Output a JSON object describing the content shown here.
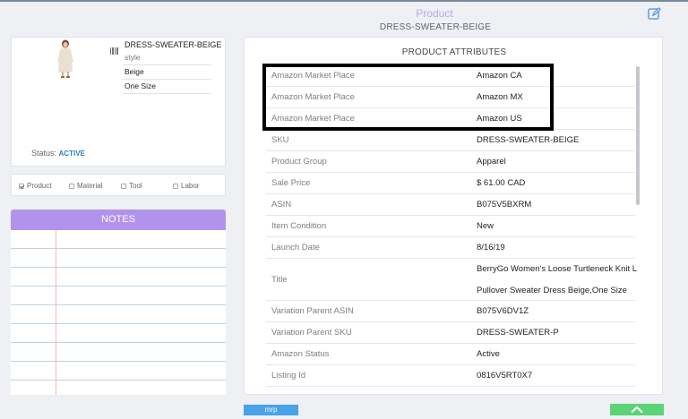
{
  "header": {
    "title": "Product",
    "subtitle": "DRESS-SWEATER-BEIGE",
    "edit_icon": "edit-icon"
  },
  "product_card": {
    "sku": "DRESS-SWEATER-BEIGE",
    "style_placeholder": "style",
    "color": "Beige",
    "size": "One Size",
    "status_label": "Status:",
    "status_value": "ACTIVE",
    "status_color": "#2f7fbf"
  },
  "types": [
    {
      "label": "Product",
      "checked": true
    },
    {
      "label": "Material",
      "checked": false
    },
    {
      "label": "Tool",
      "checked": false
    },
    {
      "label": "Labor",
      "checked": false
    }
  ],
  "notes": {
    "title": "NOTES",
    "header_color": "#b193ee"
  },
  "attributes": {
    "title": "PRODUCT ATTRIBUTES",
    "rows": [
      {
        "label": "Amazon Market Place",
        "value": "Amazon CA"
      },
      {
        "label": "Amazon Market Place",
        "value": "Amazon MX"
      },
      {
        "label": "Amazon Market Place",
        "value": "Amazon US"
      },
      {
        "label": "SKU",
        "value": "DRESS-SWEATER-BEIGE"
      },
      {
        "label": "Product Group",
        "value": "Apparel"
      },
      {
        "label": "Sale Price",
        "value": "$ 61.00 CAD"
      },
      {
        "label": "ASIN",
        "value": "B075V5BXRM"
      },
      {
        "label": "Item Condition",
        "value": "New"
      },
      {
        "label": "Launch Date",
        "value": "8/16/19"
      },
      {
        "label": "Title",
        "value": "BerryGo Women's Loose Turtleneck Knit L",
        "value2": "Pullover Sweater Dress Beige,One Size"
      },
      {
        "label": "Variation Parent ASIN",
        "value": "B075V6DV1Z"
      },
      {
        "label": "Variation Parent SKU",
        "value": "DRESS-SWEATER-P"
      },
      {
        "label": "Amazon Status",
        "value": "Active"
      },
      {
        "label": "Listing Id",
        "value": "0816V5RT0X7"
      }
    ]
  },
  "footer": {
    "mrp_label": "mrp",
    "mrp_color": "#4aa3e8",
    "up_icon": "chevron-up-icon",
    "up_color": "#5cd375"
  }
}
